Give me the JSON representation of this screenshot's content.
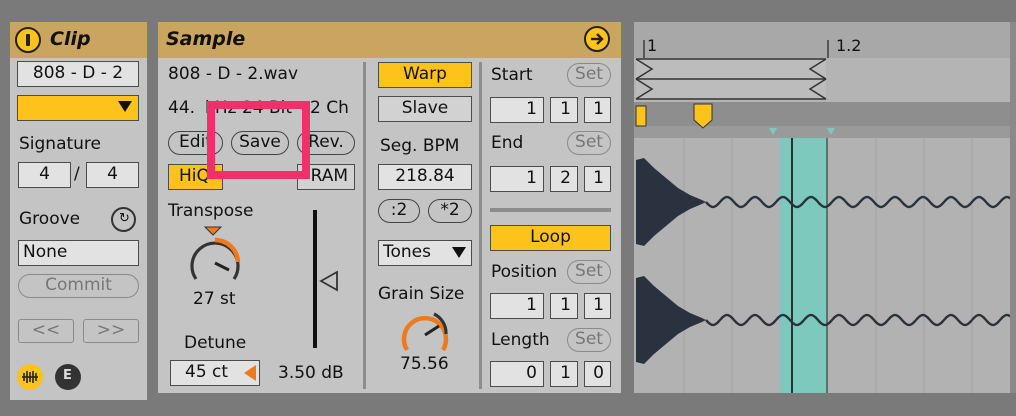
{
  "clip": {
    "title": "Clip",
    "name": "808 - D - 2",
    "signature_label": "Signature",
    "sig_num": "4",
    "sig_sep": "/",
    "sig_den": "4",
    "groove_label": "Groove",
    "groove_value": "None",
    "commit_label": "Commit",
    "prev_label": "<<",
    "next_label": ">>"
  },
  "sample": {
    "title": "Sample",
    "filename": "808 - D - 2.wav",
    "info_left": "44.",
    "info_mid": "kHz 24 Bit",
    "info_right": "2 Ch",
    "edit_label": "Edit",
    "save_label": "Save",
    "rev_label": "Rev.",
    "hiq_label": "HiQ",
    "ram_label": "RAM",
    "transpose_label": "Transpose",
    "transpose_value": "27 st",
    "detune_label": "Detune",
    "detune_value": "45 ct",
    "gain_value": "3.50 dB",
    "warp_label": "Warp",
    "slave_label": "Slave",
    "seg_bpm_label": "Seg. BPM",
    "seg_bpm_value": "218.84",
    "half_label": ":2",
    "double_label": "*2",
    "warp_mode": "Tones",
    "grain_size_label": "Grain Size",
    "grain_size_value": "75.56",
    "start_label": "Start",
    "end_label": "End",
    "set_label": "Set",
    "start": [
      "1",
      "1",
      "1"
    ],
    "end": [
      "1",
      "2",
      "1"
    ],
    "loop_label": "Loop",
    "position_label": "Position",
    "length_label": "Length",
    "position": [
      "1",
      "1",
      "1"
    ],
    "length": [
      "0",
      "1",
      "0"
    ]
  },
  "editor": {
    "ruler_1": "1",
    "ruler_2": "1.2"
  },
  "colors": {
    "accent": "#fdc31b",
    "header": "#c9a560",
    "highlight_box": "#f0306a",
    "loop_region": "#7ec9bd",
    "knob_arc": "#ef7a1c"
  }
}
